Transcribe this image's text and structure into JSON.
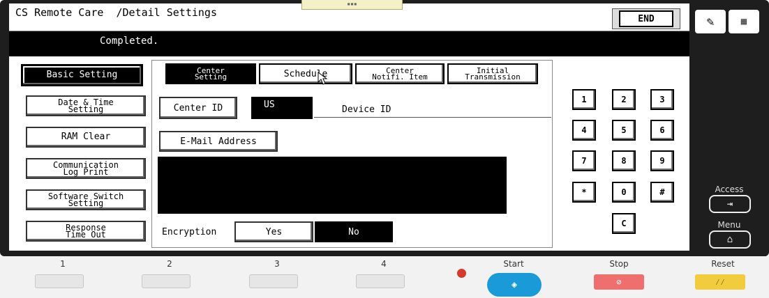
{
  "header": {
    "title": "CS Remote Care  /Detail Settings",
    "end_label": "END"
  },
  "status": {
    "message": "Completed."
  },
  "left_menu": [
    {
      "line1": "Basic Setting",
      "line2": ""
    },
    {
      "line1": "Date & Time",
      "line2": "Setting"
    },
    {
      "line1": "RAM Clear",
      "line2": ""
    },
    {
      "line1": "Communication",
      "line2": "Log Print"
    },
    {
      "line1": "Software Switch",
      "line2": "Setting"
    },
    {
      "line1": "Response",
      "line2": "Time Out"
    }
  ],
  "tabs": [
    {
      "line1": "Center",
      "line2": "Setting"
    },
    {
      "line1": "Schedule",
      "line2": ""
    },
    {
      "line1": "Center",
      "line2": "Notifi. Item"
    },
    {
      "line1": "Initial",
      "line2": "Transmission"
    }
  ],
  "form": {
    "center_id_label": "Center ID",
    "center_id_value": "US",
    "device_id_label": "Device ID",
    "email_label": "E-Mail Address",
    "encryption_label": "Encryption",
    "yes_label": "Yes",
    "no_label": "No"
  },
  "keypad": [
    "1",
    "2",
    "3",
    "4",
    "5",
    "6",
    "7",
    "8",
    "9",
    "*",
    "0",
    "#",
    "C"
  ],
  "side": {
    "access_label": "Access",
    "menu_label": "Menu"
  },
  "hardware": {
    "keys": [
      "1",
      "2",
      "3",
      "4"
    ],
    "start_label": "Start",
    "stop_label": "Stop",
    "reset_label": "Reset"
  },
  "colors": {
    "start": "#1a9ad6",
    "stop": "#ef6f6f",
    "reset": "#f1cc3c",
    "indicator": "#d63a2b"
  }
}
